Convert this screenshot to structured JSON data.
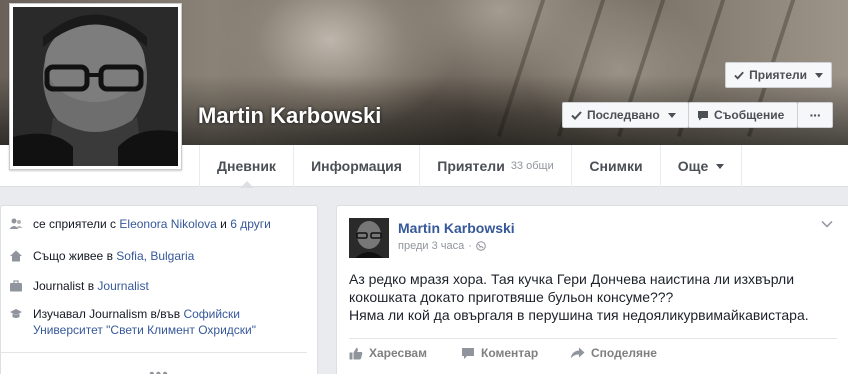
{
  "profile": {
    "name": "Martin Karbowski"
  },
  "cover_buttons": {
    "friends": "Приятели",
    "following": "Последвано",
    "message": "Съобщение",
    "more": "···"
  },
  "tabs": [
    {
      "label": "Дневник",
      "active": true
    },
    {
      "label": "Информация"
    },
    {
      "label": "Приятели",
      "count": "33 общи"
    },
    {
      "label": "Снимки"
    },
    {
      "label": "Още"
    }
  ],
  "info": {
    "mutual_prefix": "се сприятели с",
    "mutual_name": "Eleonora Nikolova",
    "mutual_mid": "и",
    "mutual_others": "6 други",
    "lives_prefix": "Също живее в",
    "lives_place": "Sofia, Bulgaria",
    "job_prefix": "Journalist в",
    "job_place": "Journalist",
    "study_prefix": "Изучавал Journalism в/във",
    "study_school_line1": "Софийски",
    "study_school_line2": "Университет \"Свети Климент Охридски\"",
    "more": "•••"
  },
  "post": {
    "author": "Martin Karbowski",
    "time": "преди 3 часа",
    "text_lines": [
      "Аз редко мразя хора. Тая кучка Гери Дончева наистина ли изхвърли",
      "кокошката докато приготвяше бульон консуме???",
      "Няма ли кой да овъргаля в перушина тия недояликурвимайкавистара."
    ],
    "actions": {
      "like": "Харесвам",
      "comment": "Коментар",
      "share": "Споделяне"
    }
  },
  "colors": {
    "link": "#365899",
    "background": "#e9ebee"
  }
}
